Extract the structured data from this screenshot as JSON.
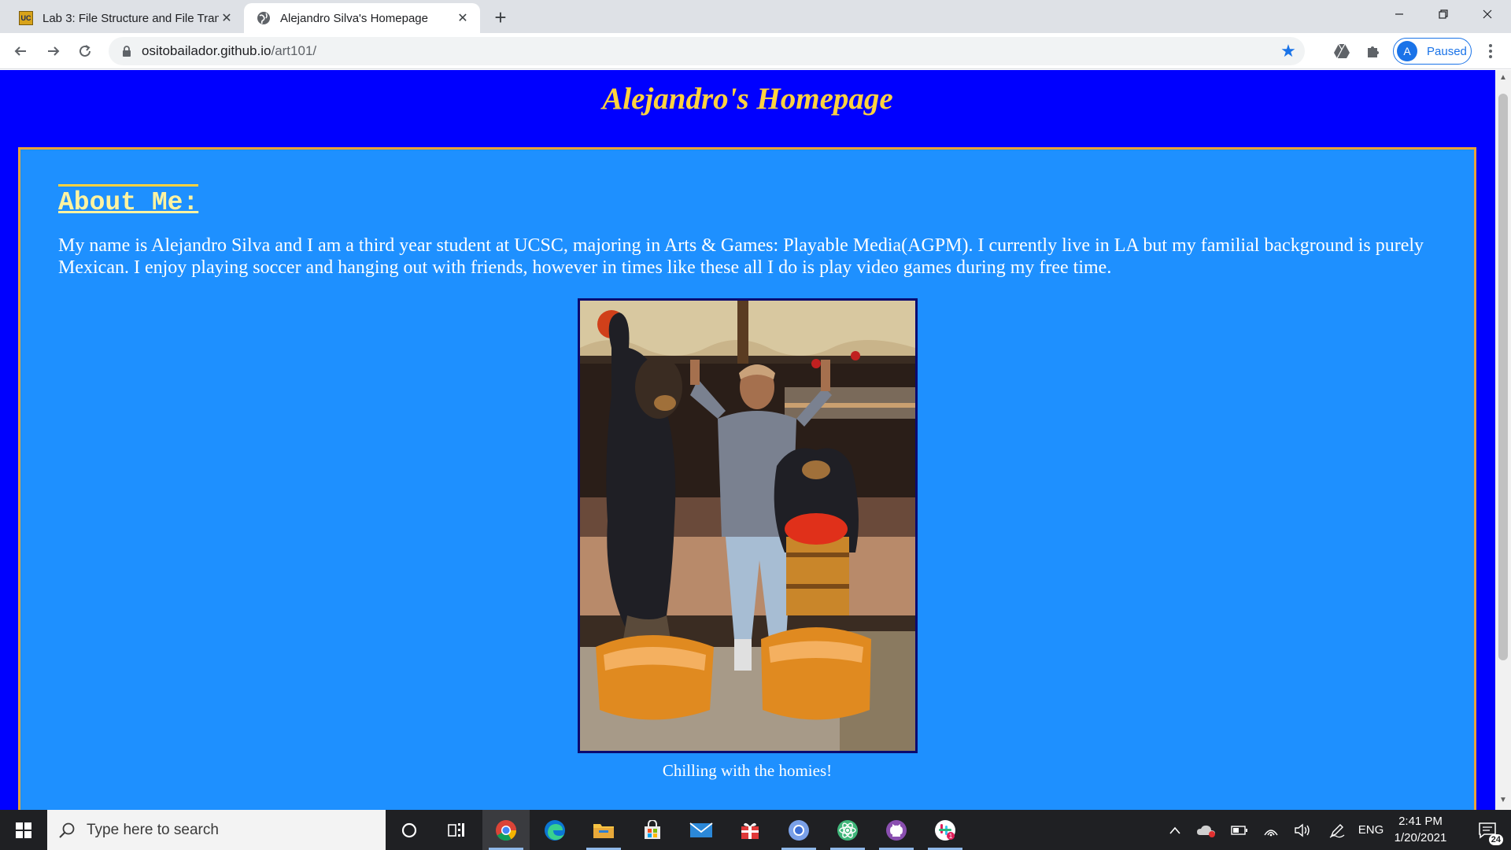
{
  "browser": {
    "tabs": [
      {
        "title": "Lab 3: File Structure and File Tran",
        "favicon": "ucsc-icon",
        "active": false
      },
      {
        "title": "Alejandro Silva's Homepage",
        "favicon": "globe-icon",
        "active": true
      }
    ],
    "url": {
      "host": "ositobailador.github.io",
      "path": "/art101/"
    },
    "profile": {
      "initial": "A",
      "status": "Paused"
    }
  },
  "page": {
    "title": "Alejandro's Homepage",
    "about_heading": "About Me:",
    "about_text": "My name is Alejandro Silva and I am a third year student at UCSC, majoring in Arts & Games: Playable Media(AGPM). I currently live in LA but my familial background is purely Mexican. I enjoy playing soccer and hanging out with friends, however in times like these all I do is play video games during my free time.",
    "photo_caption": "Chilling with the homies!",
    "colors": {
      "background": "#0000ff",
      "box": "#1e90ff",
      "border": "#e8a33a",
      "title": "#ffd23f"
    }
  },
  "taskbar": {
    "search_placeholder": "Type here to search",
    "apps": [
      "cortana-icon",
      "task-view-icon",
      "chrome-icon",
      "edge-icon",
      "file-explorer-icon",
      "store-icon",
      "mail-icon",
      "gift-icon",
      "chromium-icon",
      "atom-icon",
      "github-icon",
      "slack-icon"
    ],
    "language": "ENG",
    "time": "2:41 PM",
    "date": "1/20/2021",
    "notifications": "24"
  }
}
